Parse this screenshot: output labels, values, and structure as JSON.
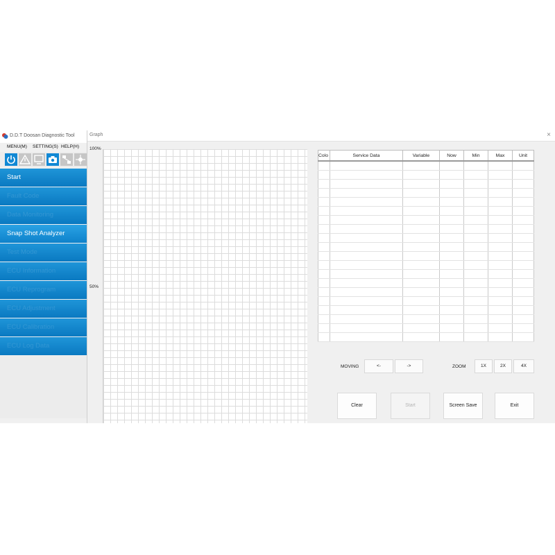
{
  "app": {
    "title": "D.D.T Doosan Diagnostic Tool",
    "menu": [
      "MENU(M)",
      "SETTING(S)",
      "HELP(H)"
    ],
    "toolbar": [
      "power-icon",
      "warning-icon",
      "monitor-icon",
      "camera-icon",
      "network-icon",
      "settings-network-icon"
    ],
    "nav": [
      {
        "label": "Start",
        "state": "normal"
      },
      {
        "label": "Fault Code",
        "state": "blurred"
      },
      {
        "label": "Data Monitoring",
        "state": "blurred"
      },
      {
        "label": "Snap Shot Analyzer",
        "state": "normal"
      },
      {
        "label": "Test Mode",
        "state": "blurred"
      },
      {
        "label": "ECU Information",
        "state": "blurred"
      },
      {
        "label": "ECU Reprogram",
        "state": "blurred"
      },
      {
        "label": "ECU Adjustment",
        "state": "blurred"
      },
      {
        "label": "ECU Calibration",
        "state": "blurred"
      },
      {
        "label": "ECU Log Data",
        "state": "blurred"
      }
    ],
    "accent_color": "#0a79c1"
  },
  "graph_window": {
    "title": "Graph",
    "close": "×",
    "y_axis": {
      "top_label": "100%",
      "mid_label": "50%"
    },
    "table": {
      "columns": [
        "Colo",
        "Service Data",
        "Variable",
        "Now",
        "Min",
        "Max",
        "Unit"
      ],
      "row_count": 20
    },
    "moving": {
      "label": "MOVING",
      "left": "<-",
      "right": "->"
    },
    "zoom": {
      "label": "ZOOM",
      "options": [
        "1X",
        "2X",
        "4X"
      ]
    },
    "buttons": {
      "clear": "Clear",
      "start": "Start",
      "screen_save": "Screen Save",
      "exit": "Exit"
    }
  }
}
